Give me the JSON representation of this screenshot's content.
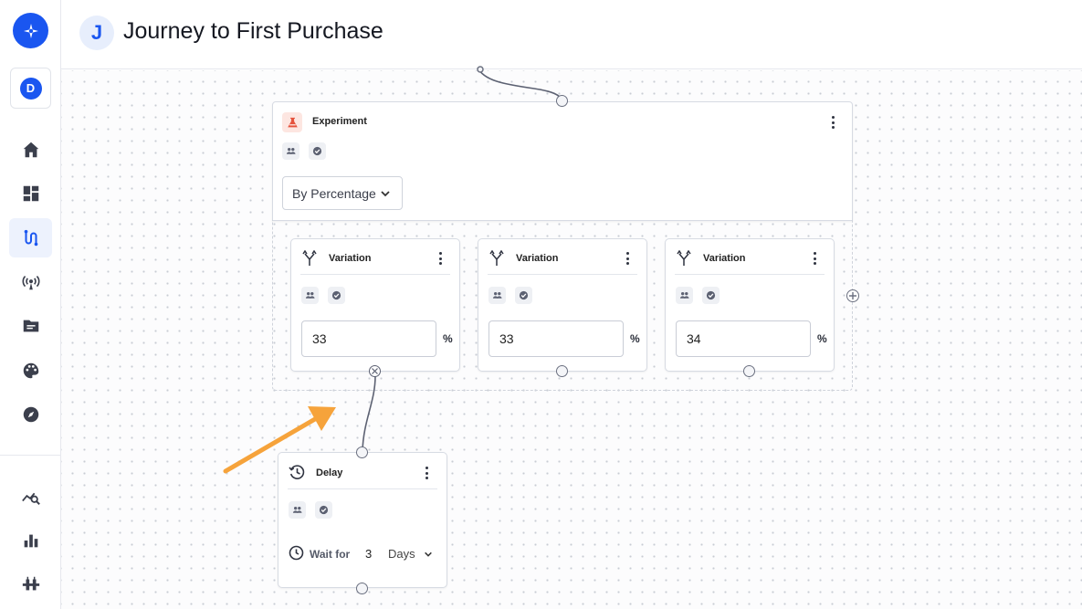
{
  "app": {
    "logo_icon": "spark-logo-icon",
    "brand_color": "#1a56f0",
    "workspace_initial": "D"
  },
  "sidebar": {
    "items": [
      {
        "name": "home",
        "icon": "home-icon",
        "active": false
      },
      {
        "name": "dashboard",
        "icon": "dashboard-icon",
        "active": false
      },
      {
        "name": "journeys",
        "icon": "journey-icon",
        "active": true
      },
      {
        "name": "broadcasts",
        "icon": "broadcast-icon",
        "active": false
      },
      {
        "name": "content",
        "icon": "folder-icon",
        "active": false
      },
      {
        "name": "design",
        "icon": "palette-icon",
        "active": false
      },
      {
        "name": "explore",
        "icon": "compass-icon",
        "active": false
      },
      {
        "name": "analytics",
        "icon": "analytics-icon",
        "active": false
      },
      {
        "name": "reports",
        "icon": "bar-chart-icon",
        "active": false
      },
      {
        "name": "integrations",
        "icon": "plug-icon",
        "active": false
      }
    ]
  },
  "header": {
    "badge": "J",
    "title": "Journey to First Purchase"
  },
  "experiment": {
    "title": "Experiment",
    "icon": "flask-icon",
    "split_mode": "By Percentage",
    "accent_color": "#e5533d"
  },
  "variations": [
    {
      "title": "Variation",
      "percent": "33",
      "unit": "%"
    },
    {
      "title": "Variation",
      "percent": "33",
      "unit": "%"
    },
    {
      "title": "Variation",
      "percent": "34",
      "unit": "%"
    }
  ],
  "delay": {
    "title": "Delay",
    "wait_label": "Wait for",
    "amount": "3",
    "unit": "Days"
  },
  "annotation": {
    "arrow_color": "#f6a33b"
  }
}
